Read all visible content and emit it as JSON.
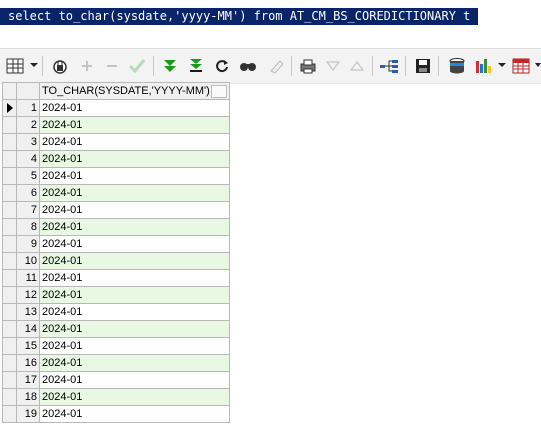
{
  "editor": {
    "sql": "select to_char(sysdate,'yyyy-MM') from AT_CM_BS_COREDICTIONARY t"
  },
  "toolbar": {
    "icons": [
      "grid-view-icon",
      "lock-icon",
      "plus-icon",
      "minus-icon",
      "check-icon",
      "fetch-next-icon",
      "fetch-last-icon",
      "refresh-icon",
      "find-icon",
      "clear-icon",
      "print-icon",
      "filter-down-icon",
      "filter-up-icon",
      "query-tree-icon",
      "save-icon",
      "export-icon",
      "chart-icon",
      "table-icon"
    ]
  },
  "grid": {
    "column_header": "TO_CHAR(SYSDATE,'YYYY-MM')",
    "rows": [
      {
        "num": "1",
        "value": "2024-01"
      },
      {
        "num": "2",
        "value": "2024-01"
      },
      {
        "num": "3",
        "value": "2024-01"
      },
      {
        "num": "4",
        "value": "2024-01"
      },
      {
        "num": "5",
        "value": "2024-01"
      },
      {
        "num": "6",
        "value": "2024-01"
      },
      {
        "num": "7",
        "value": "2024-01"
      },
      {
        "num": "8",
        "value": "2024-01"
      },
      {
        "num": "9",
        "value": "2024-01"
      },
      {
        "num": "10",
        "value": "2024-01"
      },
      {
        "num": "11",
        "value": "2024-01"
      },
      {
        "num": "12",
        "value": "2024-01"
      },
      {
        "num": "13",
        "value": "2024-01"
      },
      {
        "num": "14",
        "value": "2024-01"
      },
      {
        "num": "15",
        "value": "2024-01"
      },
      {
        "num": "16",
        "value": "2024-01"
      },
      {
        "num": "17",
        "value": "2024-01"
      },
      {
        "num": "18",
        "value": "2024-01"
      },
      {
        "num": "19",
        "value": "2024-01"
      }
    ]
  },
  "colors": {
    "selection": "#0a246a",
    "alt_row": "#e8f8e3"
  }
}
